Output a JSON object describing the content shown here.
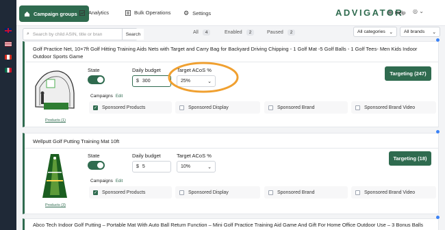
{
  "nav": {
    "campaign_groups": "Campaign groups",
    "analytics": "Analytics",
    "bulk_operations": "Bulk Operations",
    "settings": "Settings",
    "logo": "ADVIGATOR",
    "help": "Help",
    "user_chevron": "⌄"
  },
  "filters": {
    "search_placeholder": "Search by child ASIN, title or bran",
    "search_button": "Search",
    "tabs": [
      {
        "label": "All",
        "count": "4"
      },
      {
        "label": "Enabled",
        "count": "2"
      },
      {
        "label": "Paused",
        "count": "2"
      }
    ],
    "categories": "All categories",
    "brands": "All brands"
  },
  "cards": [
    {
      "title": "Golf Practice Net, 10×7ft Golf Hitting Training Aids Nets with Target and Carry Bag for Backyard Driving Chipping - 1 Golf Mat -5 Golf Balls - 1 Golf Tees- Men Kids Indoor Outdoor Sports Game",
      "state_label": "State",
      "budget_label": "Daily budget",
      "currency": "$",
      "budget_value": "300",
      "acos_label": "Target ACoS %",
      "acos_value": "25%",
      "targeting": "Targeting (247)",
      "campaigns_label": "Campaigns",
      "edit": "Edit",
      "products": "Products (1)",
      "types": [
        "Sponsored Products",
        "Sponsored Display",
        "Sponsored Brand",
        "Sponsored Brand Video"
      ]
    },
    {
      "title": "Wellputt Golf Putting Training Mat 10ft",
      "state_label": "State",
      "budget_label": "Daily budget",
      "currency": "$",
      "budget_value": "5",
      "acos_label": "Target ACoS %",
      "acos_value": "10%",
      "targeting": "Targeting (18)",
      "campaigns_label": "Campaigns",
      "edit": "Edit",
      "products": "Products (3)",
      "types": [
        "Sponsored Products",
        "Sponsored Display",
        "Sponsored Brand",
        "Sponsored Brand Video"
      ]
    },
    {
      "title": "Abco Tech Indoor Golf Putting – Portable Mat With Auto Ball Return Function – Mini Golf Practice Training Aid Game And Gift For Home Office Outdoor Use – 3 Bonus Balls"
    }
  ],
  "colors": {
    "accent": "#2f6b4f",
    "highlight": "#f0a030"
  }
}
